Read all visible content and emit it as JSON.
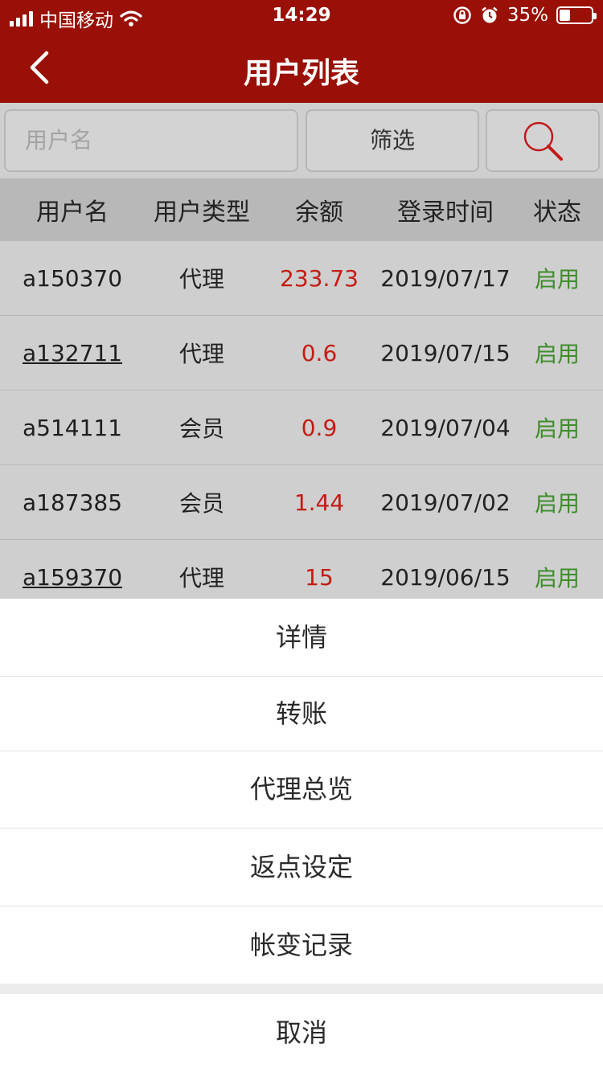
{
  "status_bar": {
    "carrier": "中国移动",
    "time": "14:29",
    "battery": "35%",
    "battery_level": 0.35
  },
  "nav": {
    "title": "用户列表",
    "back_icon": "chevron-left-icon"
  },
  "search": {
    "placeholder": "用户名",
    "filter_label": "筛选",
    "search_icon": "magnifier-icon"
  },
  "table": {
    "headers": [
      "用户名",
      "用户类型",
      "余额",
      "登录时间",
      "状态"
    ],
    "rows": [
      {
        "username": "a150370",
        "type": "代理",
        "balance": "233.73",
        "login": "2019/07/17",
        "status": "启用"
      },
      {
        "username": "a132711",
        "type": "代理",
        "balance": "0.6",
        "login": "2019/07/15",
        "status": "启用"
      },
      {
        "username": "a514111",
        "type": "会员",
        "balance": "0.9",
        "login": "2019/07/04",
        "status": "启用"
      },
      {
        "username": "a187385",
        "type": "会员",
        "balance": "1.44",
        "login": "2019/07/02",
        "status": "启用"
      },
      {
        "username": "a159370",
        "type": "代理",
        "balance": "15",
        "login": "2019/06/15",
        "status": "启用"
      }
    ]
  },
  "action_sheet": {
    "items": [
      "详情",
      "转账",
      "代理总览",
      "返点设定",
      "帐变记录"
    ],
    "cancel": "取消"
  },
  "colors": {
    "brand": "#9a1006",
    "balance": "#c41c14",
    "status_enabled": "#3f8c2c"
  }
}
